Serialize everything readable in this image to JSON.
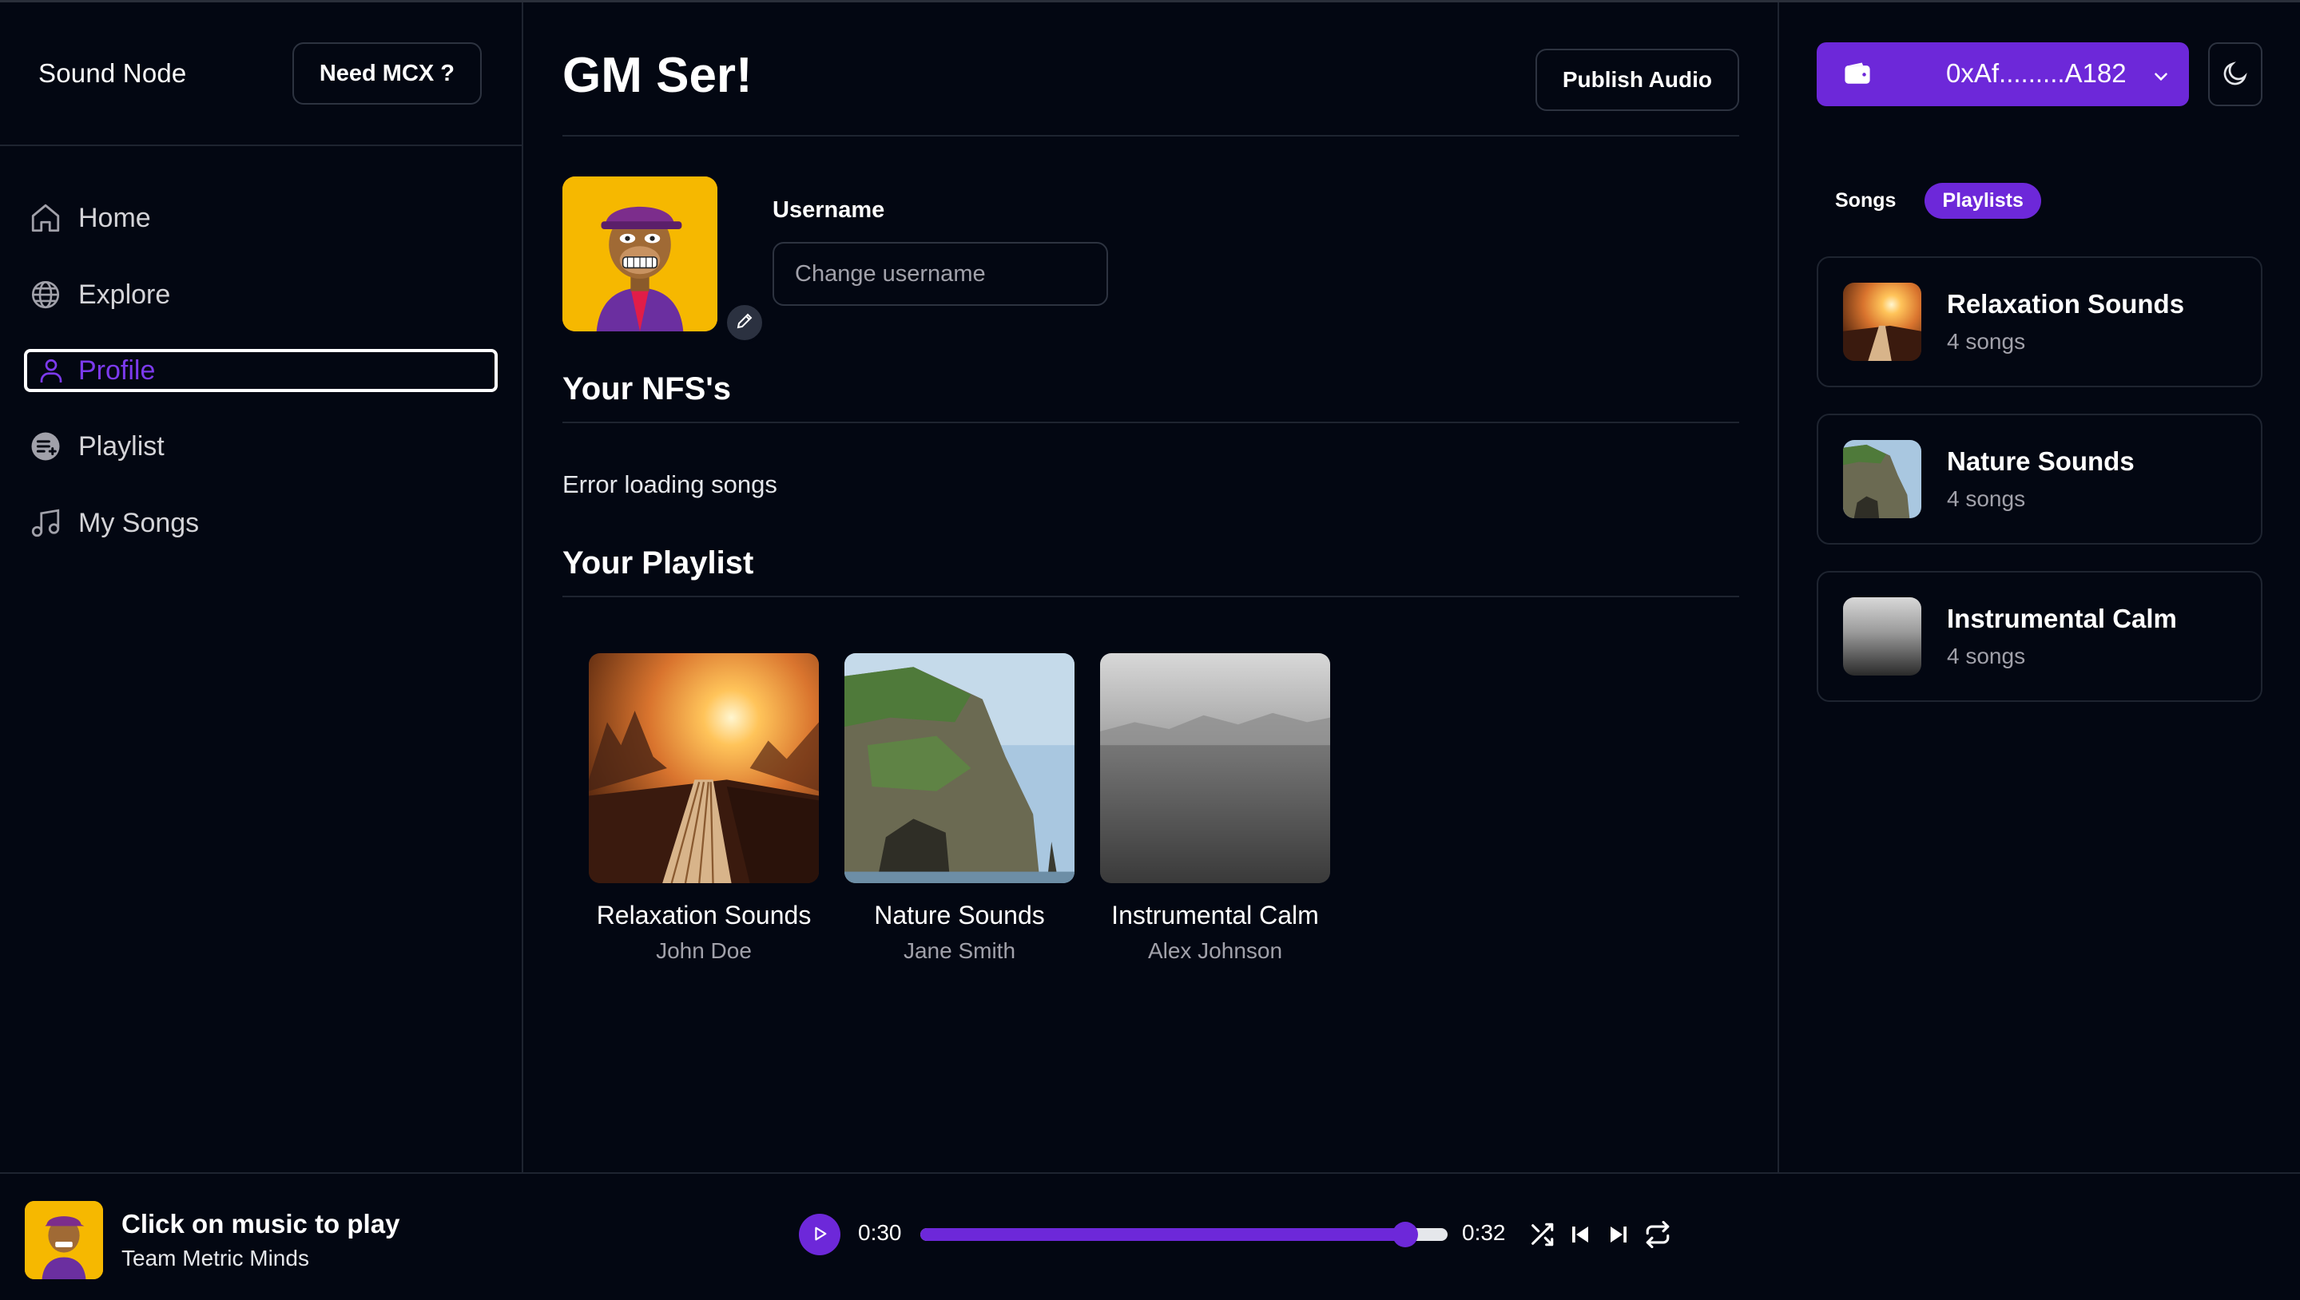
{
  "sidebar": {
    "brand": "Sound Node",
    "need_mcx_label": "Need MCX ?",
    "items": [
      {
        "label": "Home",
        "icon": "home-icon"
      },
      {
        "label": "Explore",
        "icon": "globe-icon"
      },
      {
        "label": "Profile",
        "icon": "user-icon",
        "active": true
      },
      {
        "label": "Playlist",
        "icon": "playlist-add-icon"
      },
      {
        "label": "My Songs",
        "icon": "music-note-icon"
      }
    ]
  },
  "main": {
    "greeting": "GM Ser!",
    "publish_label": "Publish Audio",
    "username_label": "Username",
    "username_placeholder": "Change username",
    "nfs_title": "Your NFS's",
    "nfs_error": "Error loading songs",
    "playlist_title": "Your Playlist",
    "playlists": [
      {
        "title": "Relaxation Sounds",
        "artist": "John Doe"
      },
      {
        "title": "Nature Sounds",
        "artist": "Jane Smith"
      },
      {
        "title": "Instrumental Calm",
        "artist": "Alex Johnson"
      }
    ]
  },
  "right": {
    "wallet_address": "0xAf.........A182",
    "tabs": [
      {
        "label": "Songs",
        "active": false
      },
      {
        "label": "Playlists",
        "active": true
      }
    ],
    "playlists": [
      {
        "name": "Relaxation Sounds",
        "count": "4 songs"
      },
      {
        "name": "Nature Sounds",
        "count": "4 songs"
      },
      {
        "name": "Instrumental Calm",
        "count": "4 songs"
      }
    ]
  },
  "player": {
    "title": "Click on music to play",
    "subtitle": "Team Metric Minds",
    "current_time": "0:30",
    "duration": "0:32",
    "progress_fraction": 0.92
  },
  "colors": {
    "accent": "#6d28d9",
    "background": "#030712",
    "border": "#1e2430",
    "avatar_bg": "#f6b800"
  }
}
